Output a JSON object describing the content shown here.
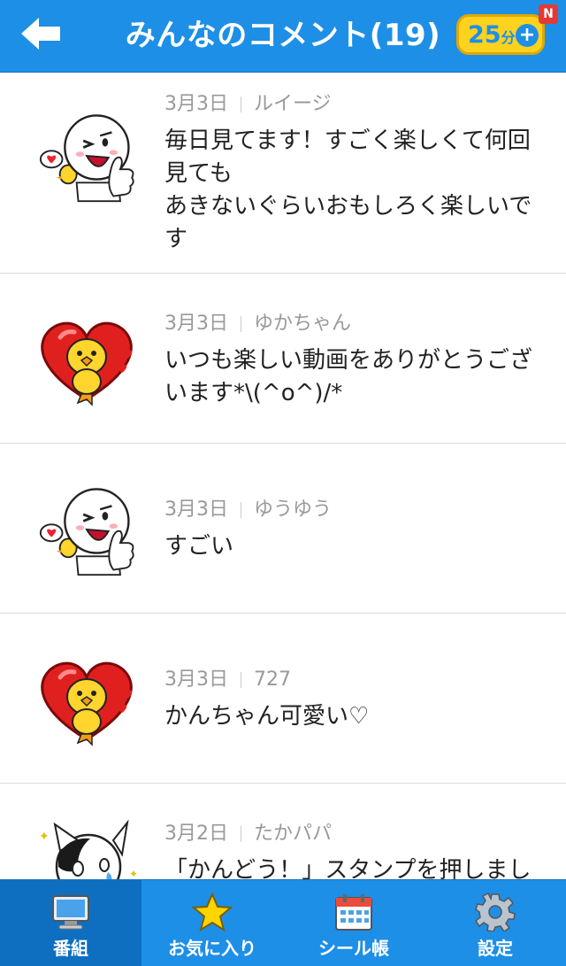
{
  "header": {
    "title": "みんなのコメント(19)",
    "points": {
      "value": "25",
      "unit": "分"
    },
    "new_badge": "N"
  },
  "comments": [
    {
      "date": "3月3日",
      "author": "ルイージ",
      "text": "毎日見てます！すごく楽しくて何回見ても\nあきないぐらいおもしろく楽しいです",
      "avatar": "moon-thumbs-up-sticker"
    },
    {
      "date": "3月3日",
      "author": "ゆかちゃん",
      "text": "いつも楽しい動画をありがとうございます*\\(^o^)/*",
      "avatar": "sally-heart-sticker"
    },
    {
      "date": "3月3日",
      "author": "ゆうゆう",
      "text": "すごい",
      "avatar": "moon-thumbs-up-sticker"
    },
    {
      "date": "3月3日",
      "author": "727",
      "text": "かんちゃん可愛い♡",
      "avatar": "sally-heart-sticker"
    },
    {
      "date": "3月2日",
      "author": "たかパパ",
      "text": "「かんどう！」スタンプを押しまし",
      "avatar": "jessica-cat-crying-sticker"
    }
  ],
  "tabs": [
    {
      "label": "番組",
      "icon": "tv-icon",
      "active": true
    },
    {
      "label": "お気に入り",
      "icon": "star-icon",
      "active": false
    },
    {
      "label": "シール帳",
      "icon": "calendar-icon",
      "active": false
    },
    {
      "label": "設定",
      "icon": "gear-icon",
      "active": false
    }
  ],
  "colors": {
    "primary": "#1e8fe6",
    "active_tab": "#0e6fc0",
    "badge": "#ffd21e"
  }
}
